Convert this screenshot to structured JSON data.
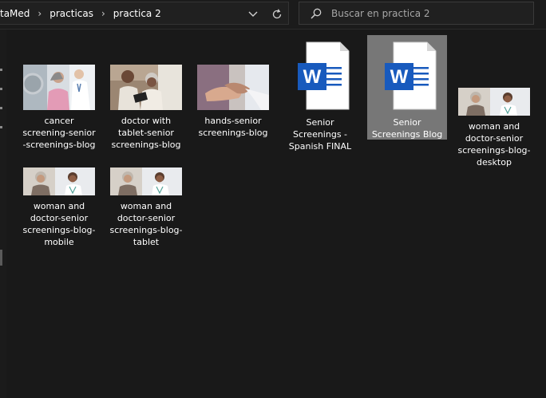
{
  "breadcrumb": {
    "items": [
      "taMed",
      "practicas",
      "practica 2"
    ],
    "separator": "›"
  },
  "search": {
    "placeholder": "Buscar en practica 2"
  },
  "files": [
    {
      "label": "cancer screening-senior -screenings-blog",
      "type": "image"
    },
    {
      "label": "doctor with tablet-senior screenings-blog",
      "type": "image"
    },
    {
      "label": "hands-senior screenings-blog",
      "type": "image"
    },
    {
      "label": "Senior Screenings - Spanish FINAL",
      "type": "word-document"
    },
    {
      "label": "Senior Screenings Blog",
      "type": "word-document",
      "selected": true
    },
    {
      "label": "woman and doctor-senior screenings-blog- desktop",
      "type": "image"
    },
    {
      "label": "woman and doctor-senior screenings-blog- mobile",
      "type": "image"
    },
    {
      "label": "woman and doctor-senior screenings-blog- tablet",
      "type": "image"
    }
  ],
  "colors": {
    "background": "#191919",
    "selected": "#777777",
    "word_blue": "#185abd"
  }
}
